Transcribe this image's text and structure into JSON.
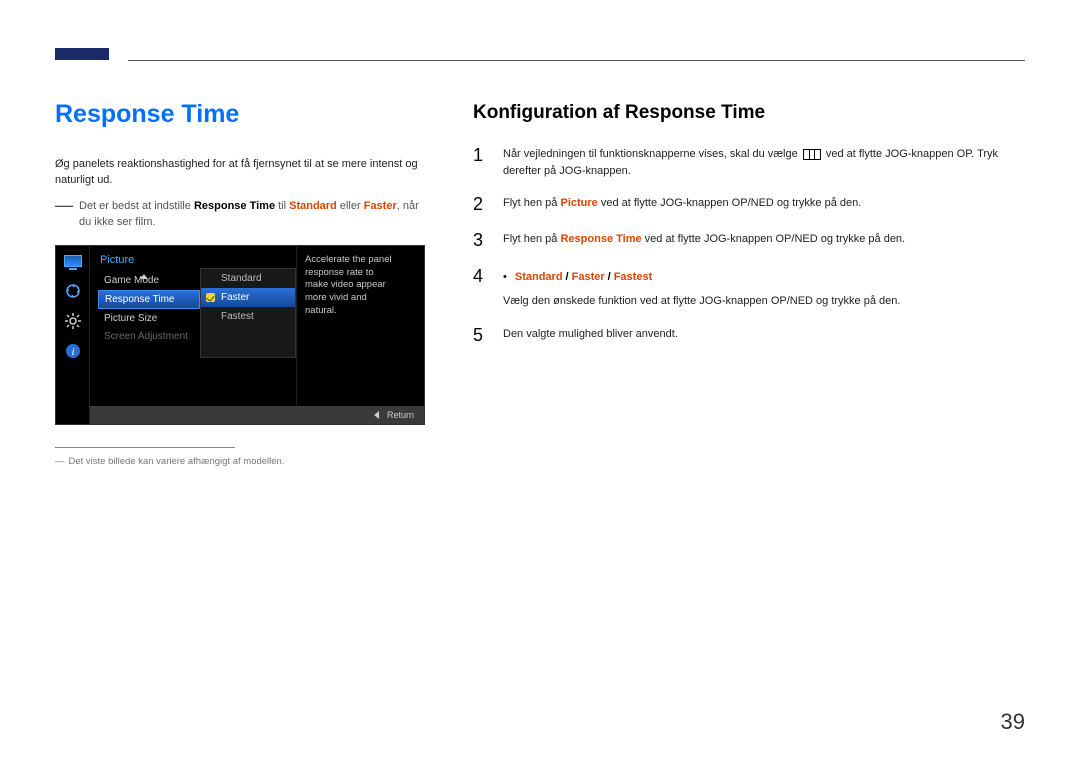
{
  "page_number": "39",
  "left": {
    "title": "Response Time",
    "intro": "Øg panelets reaktionshastighed for at få fjernsynet til at se mere intenst og naturligt ud.",
    "note_prefix": "Det er bedst at indstille ",
    "note_rt": "Response Time",
    "note_mid": " til ",
    "note_std": "Standard",
    "note_or": " eller ",
    "note_faster": "Faster",
    "note_suffix": ", når du ikke ser film.",
    "footnote": "Det viste billede kan variere afhængigt af modellen."
  },
  "osd": {
    "menu_title": "Picture",
    "items": [
      "Game Mode",
      "Response Time",
      "Picture Size",
      "Screen Adjustment"
    ],
    "sub_items": [
      "Standard",
      "Faster",
      "Fastest"
    ],
    "description": "Accelerate the panel response rate to make video appear more vivid and natural.",
    "return_label": "Return"
  },
  "right": {
    "title": "Konfiguration af Response Time",
    "steps": {
      "s1a": "Når vejledningen til funktionsknapperne vises, skal du vælge ",
      "s1b": " ved at flytte JOG-knappen OP. Tryk derefter på JOG-knappen.",
      "s2a": "Flyt hen på ",
      "s2_picture": "Picture",
      "s2b": " ved at flytte JOG-knappen OP/NED og trykke på den.",
      "s3a": "Flyt hen på ",
      "s3_rt": "Response Time",
      "s3b": " ved at flytte JOG-knappen OP/NED og trykke på den.",
      "options": {
        "o1": "Standard",
        "o2": "Faster",
        "o3": "Fastest"
      },
      "s4": "Vælg den ønskede funktion ved at flytte JOG-knappen OP/NED og trykke på den.",
      "s5": "Den valgte mulighed bliver anvendt."
    },
    "nums": {
      "n1": "1",
      "n2": "2",
      "n3": "3",
      "n4": "4",
      "n5": "5"
    }
  }
}
